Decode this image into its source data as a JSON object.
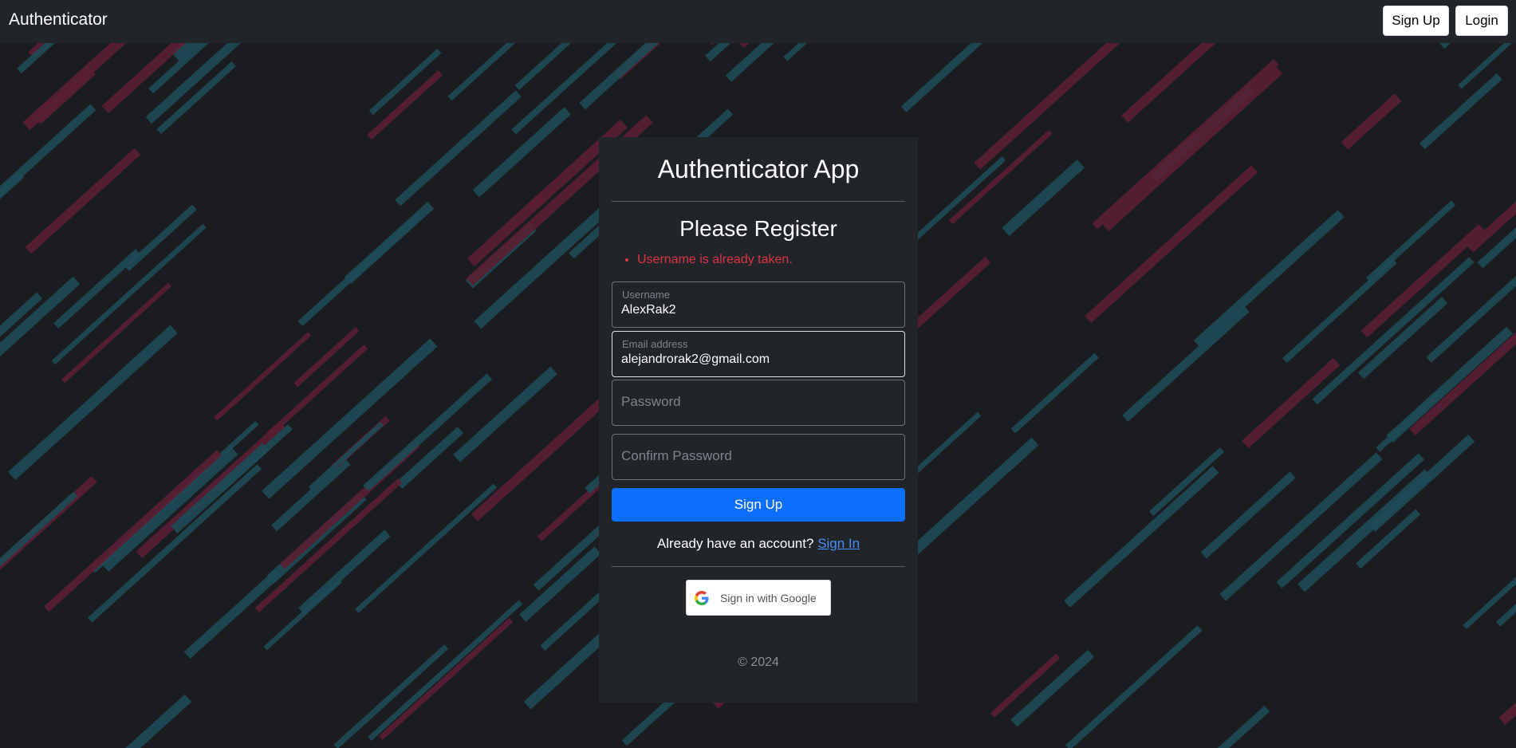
{
  "navbar": {
    "brand": "Authenticator",
    "signup_label": "Sign Up",
    "login_label": "Login"
  },
  "card": {
    "title": "Authenticator App",
    "subtitle": "Please Register",
    "errors": [
      "Username is already taken."
    ],
    "username": {
      "label": "Username",
      "value": "AlexRak2"
    },
    "email": {
      "label": "Email address",
      "value": "alejandrorak2@gmail.com"
    },
    "password": {
      "placeholder": "Password"
    },
    "confirm_password": {
      "placeholder": "Confirm Password"
    },
    "submit_label": "Sign Up",
    "signin_prompt": "Already have an account?",
    "signin_link": "Sign In",
    "google_label": "Sign in with Google",
    "footer": "© 2024"
  },
  "colors": {
    "background": "#1b1c1f",
    "navbar": "#212429",
    "card": "#212429",
    "primary": "#0d6efd",
    "error": "#dc3545",
    "stripe_teal": "#1e4b57",
    "stripe_red": "#5a1f33"
  }
}
